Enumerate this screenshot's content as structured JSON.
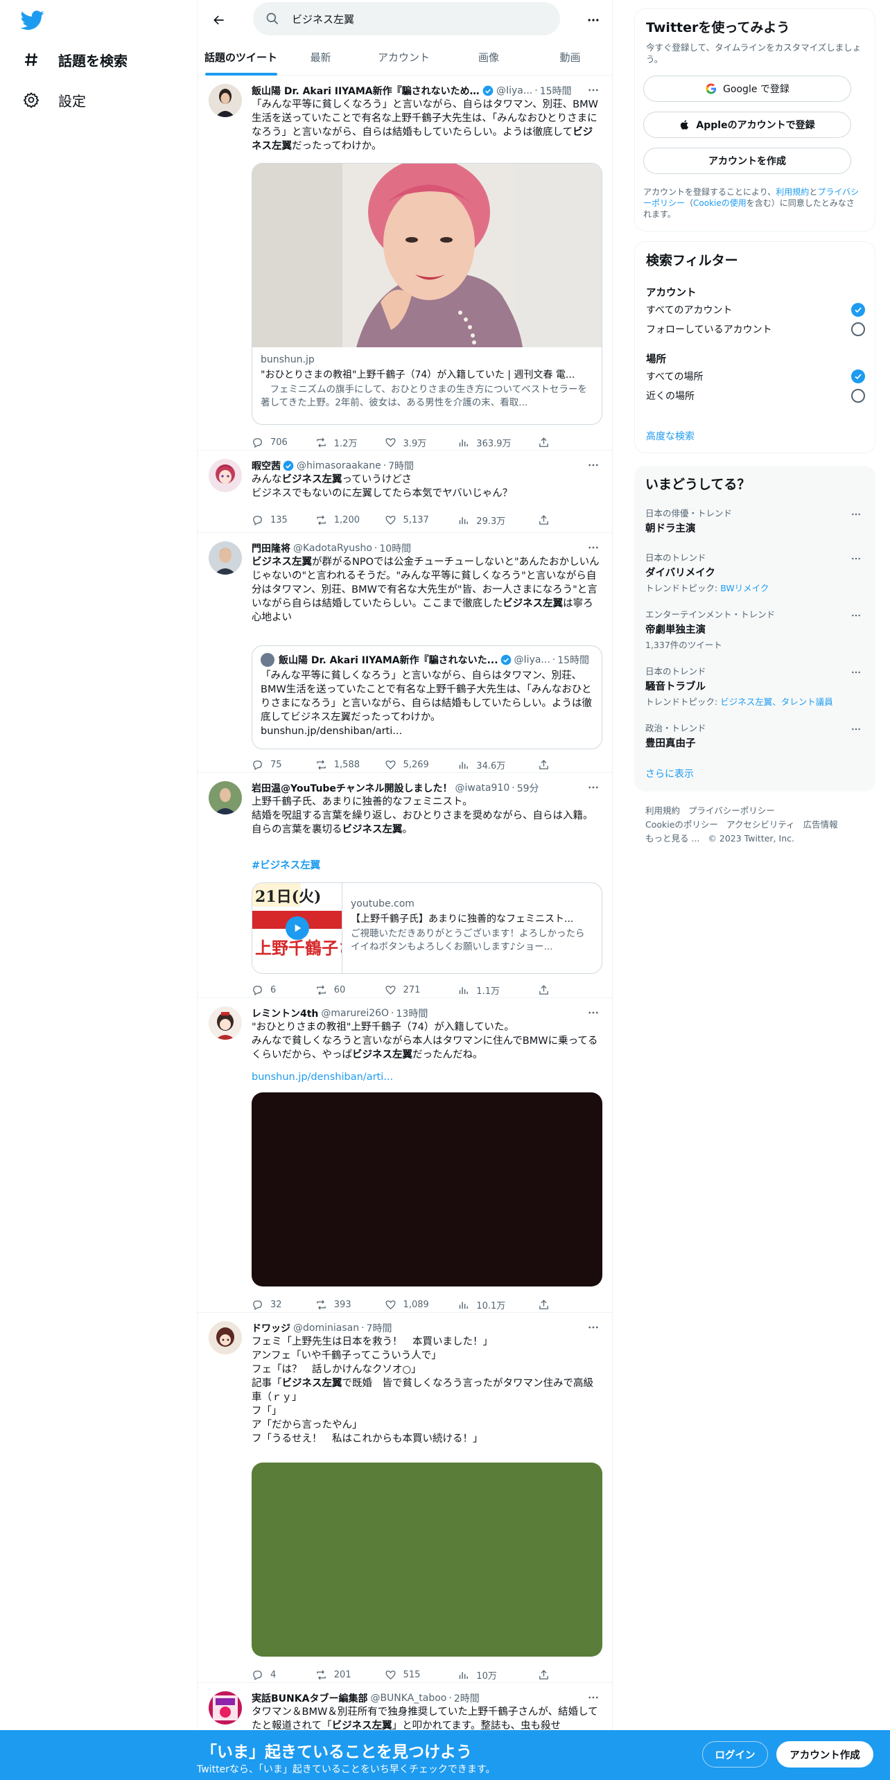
{
  "nav": {
    "explore_label": "話題を検索",
    "settings_label": "設定",
    "logo_icon": "twitter-bird-icon",
    "brand_color": "#1d9bf0"
  },
  "search": {
    "value": "ビジネス左翼"
  },
  "tabs": [
    "話題のツイート",
    "最新",
    "アカウント",
    "画像",
    "動画"
  ],
  "tweets": [
    {
      "name": "飯山陽 Dr. Akari IIYAMA新作『騙されないため...",
      "handle": "@Iiya...",
      "time": "15時間",
      "verified": true,
      "text": [
        "「みんな平等に貧しくなろう」と言いながら、自らはタワマン、別荘、BMW生活を送っていたことで有名な上野千鶴子大先生は、「みんなおひとりさまになろう」と言いながら、自らは結婚もしていたらしい。ようは徹底して",
        "ビジネス左翼",
        "だったってわけか。"
      ],
      "card": {
        "domain": "bunshun.jp",
        "title": "\"おひとりさまの教祖\"上野千鶴子（74）が入籍していた | 週刊文春 電...",
        "desc": "　フェミニズムの旗手にして、おひとりさまの生き方についてベストセラーを著してきた上野。2年前、彼女は、ある男性を介護の末、看取..."
      },
      "stats": {
        "reply": "706",
        "retweet": "1.2万",
        "like": "3.9万",
        "views": "363.9万"
      }
    },
    {
      "name": "暇空茜",
      "handle": "@himasoraakane",
      "time": "7時間",
      "verified": true,
      "text": [
        "みんな",
        "ビジネス左翼",
        "っていうけどさ\nビジネスでもないのに左翼してたら本気でヤバいじゃん？"
      ],
      "stats": {
        "reply": "135",
        "retweet": "1,200",
        "like": "5,137",
        "views": "29.3万"
      }
    },
    {
      "name": "門田隆将",
      "handle": "@KadotaRyusho",
      "time": "10時間",
      "verified": false,
      "text_parts": [
        {
          "b": "ビジネス左翼"
        },
        {
          "t": "が群がるNPOでは公金チューチューしないと\"あんたおかしいんじゃないの\"と言われるそうだ。\"みんな平等に貧しくなろう\"と言いながら自分はタワマン、別荘、BMWで有名な大先生が\"皆、お一人さまになろう\"と言いながら自らは結婚していたらしい。ここまで徹底した"
        },
        {
          "b": "ビジネス左翼"
        },
        {
          "t": "は寧ろ心地よい"
        }
      ],
      "quote": {
        "name": "飯山陽 Dr. Akari IIYAMA新作『騙されないた...",
        "handle": "@Iiya...",
        "time": "15時間",
        "text": "「みんな平等に貧しくなろう」と言いながら、自らはタワマン、別荘、BMW生活を送っていたことで有名な上野千鶴子大先生は、「みんなおひとりさまになろう」と言いながら、自らは結婚もしていたらしい。ようは徹底してビジネス左翼だったってわけか。\nbunshun.jp/denshiban/arti..."
      },
      "stats": {
        "reply": "75",
        "retweet": "1,588",
        "like": "5,269",
        "views": "34.6万"
      }
    },
    {
      "name": "岩田温@YouTubeチャンネル開設しました！",
      "handle": "@iwata910",
      "time": "59分",
      "verified": false,
      "text": [
        "上野千鶴子氏、あまりに独善的なフェミニスト。\n結婚を呪詛する言葉を繰り返し、おひとりさまを奨めながら、自らは入籍。自らの言葉を裏切る",
        "ビジネス左翼",
        "。"
      ],
      "hashtag": "#ビジネス左翼",
      "yt": {
        "domain": "youtube.com",
        "title": "【上野千鶴子氏】あまりに独善的なフェミニスト...",
        "desc": "ご視聴いただきありがとうございます！よろしかったらイイねボタンもよろしくお願いします♪ショー...",
        "thumb_date": "21日(火)",
        "thumb_text": "上野千鶴子さん"
      },
      "stats": {
        "reply": "6",
        "retweet": "60",
        "like": "271",
        "views": "1.1万"
      }
    },
    {
      "name": "レミントン4th",
      "handle": "@marurei26O",
      "time": "13時間",
      "verified": false,
      "text": [
        "\"おひとりさまの教祖\"上野千鶴子（74）が入籍していた。\nみんなで貧しくなろうと言いながら本人はタワマンに住んでBMWに乗ってるくらいだから、やっぱ",
        "ビジネス左翼",
        "だったんだね。"
      ],
      "link": "bunshun.jp/denshiban/arti...",
      "media_color": "#1a0b0c",
      "stats": {
        "reply": "32",
        "retweet": "393",
        "like": "1,089",
        "views": "10.1万"
      }
    },
    {
      "name": "ドワッジ",
      "handle": "@dominiasan",
      "time": "7時間",
      "verified": false,
      "text_parts": [
        {
          "t": "フェミ「上野先生は日本を救う！　本買いました！」\nアンフェ「いや千鶴子ってこういう人で」\nフェ「は？　話しかけんなクソオ○」\n記事「"
        },
        {
          "b": "ビジネス左翼"
        },
        {
          "t": "で既婚　皆で貧しくなろう言ったがタワマン住みで高級車（ｒｙ」\nフ「」\nア「だから言ったやん」\nフ「うるせえ！　私はこれからも本買い続ける！」"
        }
      ],
      "media_color": "#5a7d3a",
      "stats": {
        "reply": "4",
        "retweet": "201",
        "like": "515",
        "views": "10万"
      }
    },
    {
      "name": "実話BUNKAタブー編集部",
      "handle": "@BUNKA_taboo",
      "time": "2時間",
      "verified": false,
      "text_parts": [
        {
          "t": "タワマン＆BMW＆別荘所有で独身推奨していた上野千鶴子さんが、結婚してたと報道されて「"
        },
        {
          "b": "ビジネス左翼"
        },
        {
          "t": "」と叩かれてます。整誌も、虫も殺せ"
        }
      ]
    }
  ],
  "signup": {
    "title": "Twitterを使ってみよう",
    "subtitle": "今すぐ登録して、タイムラインをカスタマイズしましょう。",
    "google_label": "Google で登録",
    "apple_label": "Appleのアカウントで登録",
    "create_label": "アカウントを作成",
    "legal_1": "アカウントを登録することにより、",
    "legal_terms": "利用規約",
    "legal_2": "と",
    "legal_privacy": "プライバシーポリシー",
    "legal_3": "（",
    "legal_cookie": "Cookieの使用",
    "legal_4": "を含む）に同意したとみなされます。"
  },
  "filter": {
    "title": "検索フィルター",
    "account_label": "アカウント",
    "account_options": [
      "すべてのアカウント",
      "フォローしているアカウント"
    ],
    "account_selected": 0,
    "location_label": "場所",
    "location_options": [
      "すべての場所",
      "近くの場所"
    ],
    "location_selected": 0,
    "advanced": "高度な検索"
  },
  "trends": {
    "title": "いまどうしてる？",
    "items": [
      {
        "context": "日本の俳優・トレンド",
        "name": "朝ドラ主演",
        "extra": ""
      },
      {
        "context": "日本のトレンド",
        "name": "ダイバリメイク",
        "extra_prefix": "トレンドトピック: ",
        "extra_link": "BWリメイク"
      },
      {
        "context": "エンターテインメント・トレンド",
        "name": "帝劇単独主演",
        "extra": "1,337件のツイート"
      },
      {
        "context": "日本のトレンド",
        "name": "騒音トラブル",
        "extra_prefix": "トレンドトピック: ",
        "extra_link": "ビジネス左翼、タレント議員"
      },
      {
        "context": "政治・トレンド",
        "name": "豊田真由子",
        "extra": ""
      }
    ],
    "show_more": "さらに表示"
  },
  "footer": {
    "links": [
      "利用規約",
      "プライバシーポリシー",
      "Cookieのポリシー",
      "アクセシビリティ",
      "広告情報",
      "もっと見る ..."
    ],
    "copyright": "© 2023 Twitter, Inc."
  },
  "bottom": {
    "title": "「いま」起きていることを見つけよう",
    "subtitle": "Twitterなら、「いま」起きていることをいち早くチェックできます。",
    "login": "ログイン",
    "signup": "アカウント作成"
  }
}
